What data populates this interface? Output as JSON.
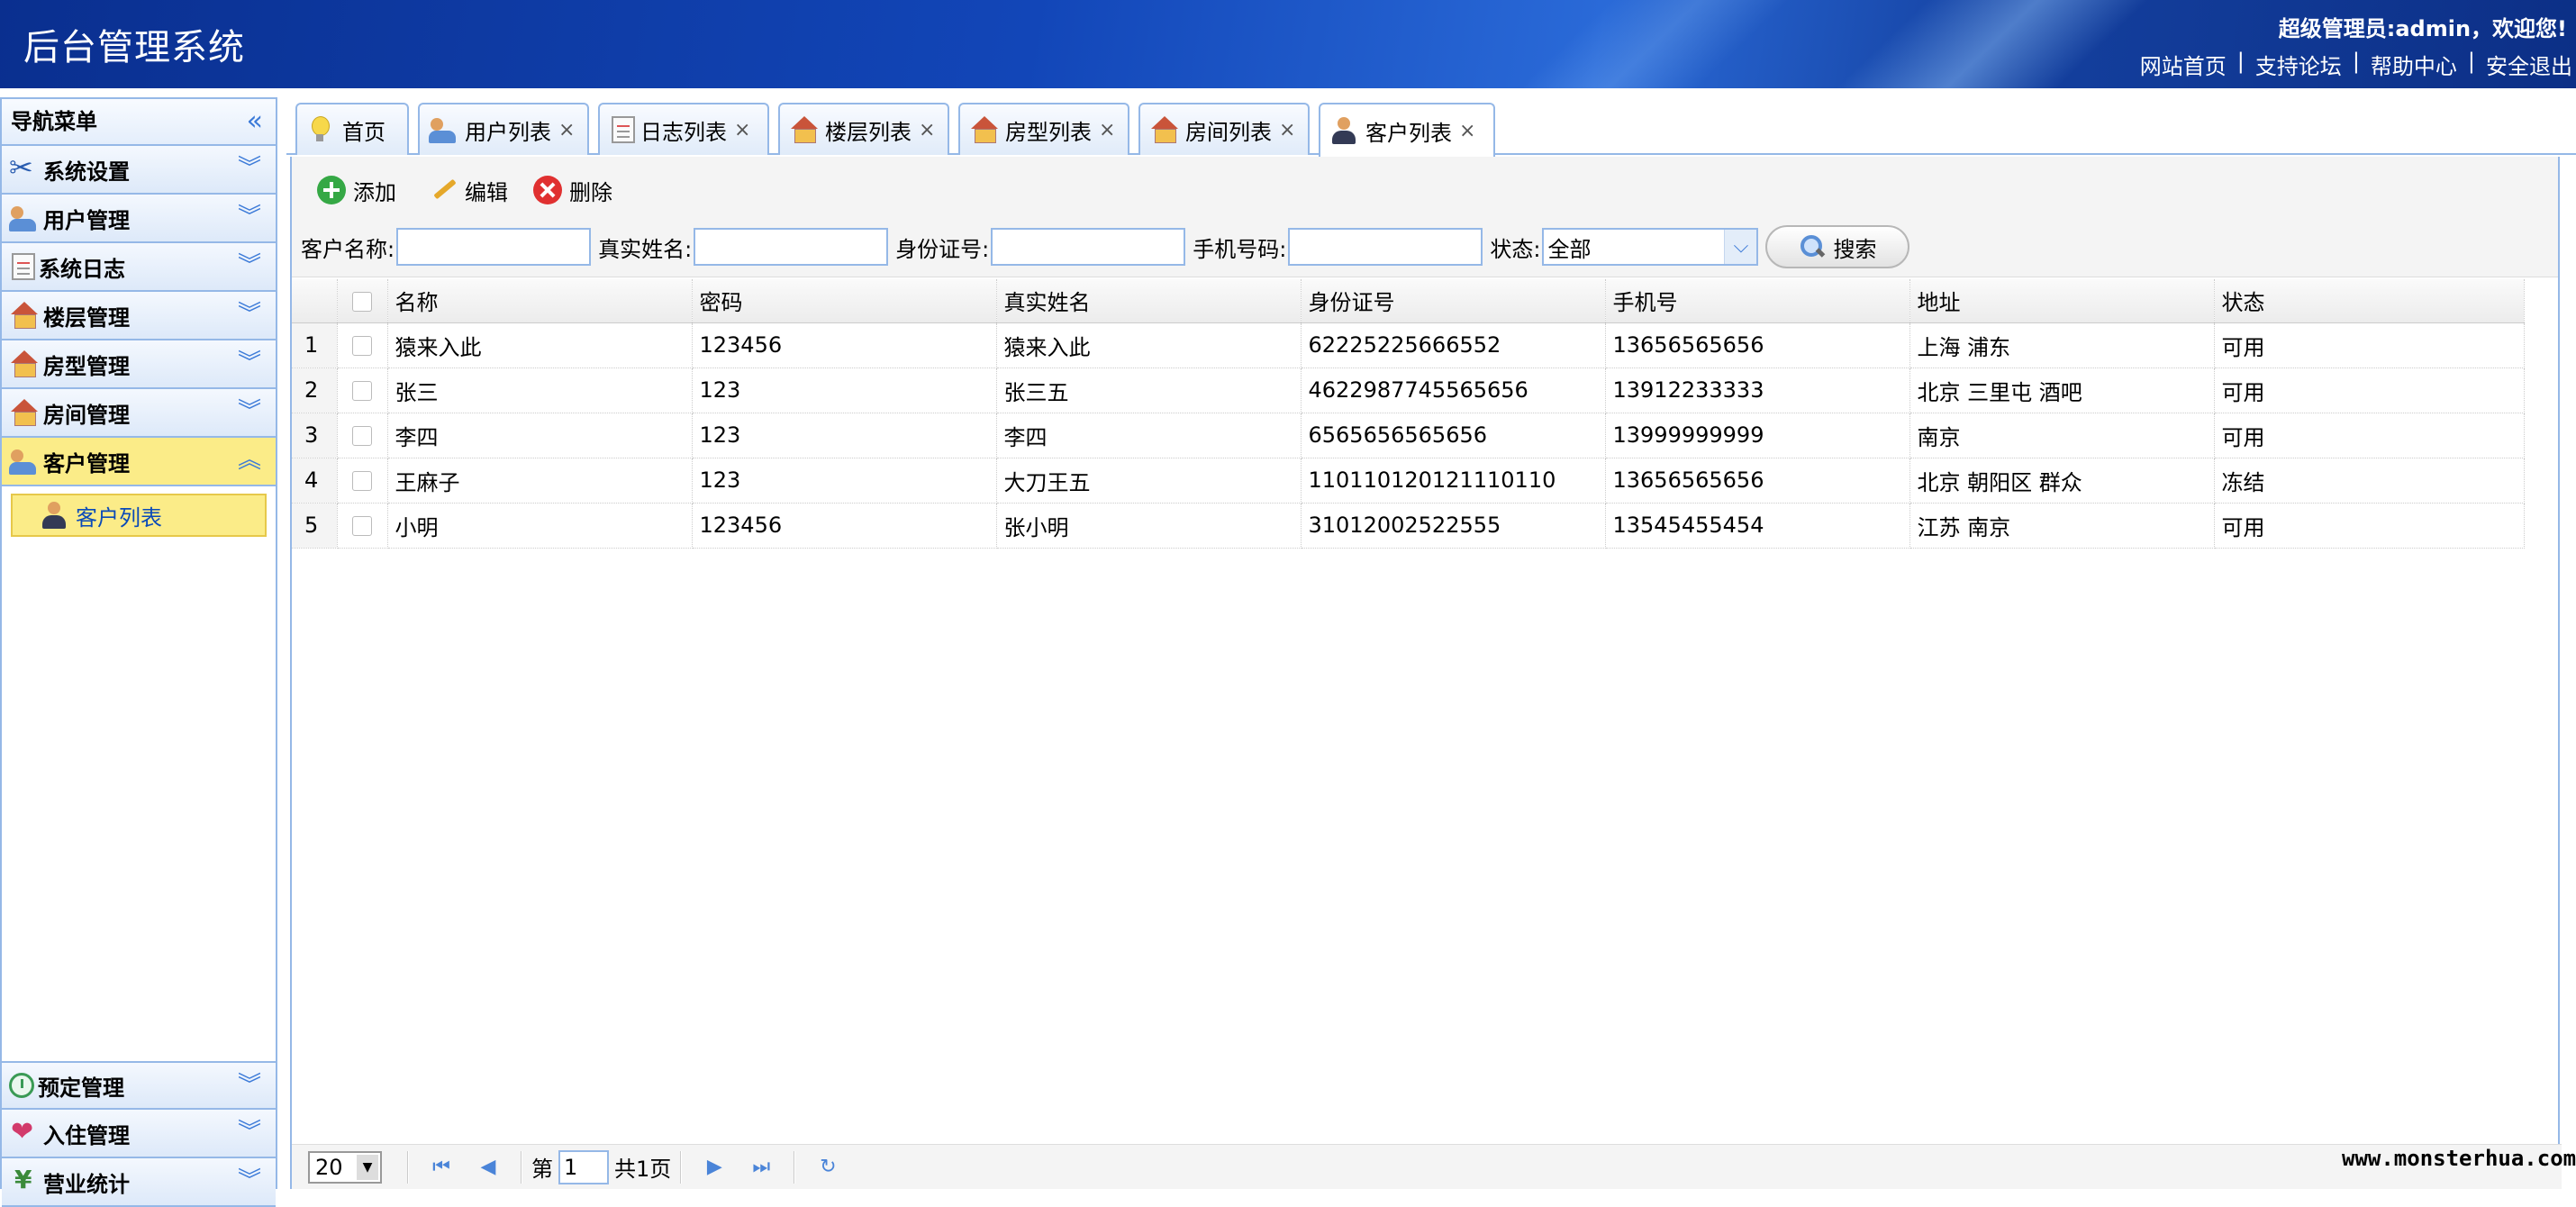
{
  "header": {
    "title": "后台管理系统",
    "welcome": "超级管理员:admin，欢迎您!",
    "links": [
      "网站首页",
      "支持论坛",
      "帮助中心",
      "安全退出"
    ],
    "separator": "|"
  },
  "sidebar": {
    "heading": "导航菜单",
    "collapse_icon": "«",
    "panels": [
      {
        "label": "系统设置",
        "icon": "tools-icon"
      },
      {
        "label": "用户管理",
        "icon": "users-icon"
      },
      {
        "label": "系统日志",
        "icon": "document-icon"
      },
      {
        "label": "楼层管理",
        "icon": "house-icon"
      },
      {
        "label": "房型管理",
        "icon": "house-icon"
      },
      {
        "label": "房间管理",
        "icon": "house-icon"
      },
      {
        "label": "客户管理",
        "icon": "users-icon",
        "active": true
      }
    ],
    "sub_items": [
      {
        "label": "客户列表",
        "icon": "person-icon"
      }
    ],
    "bottom_panels": [
      {
        "label": "预定管理",
        "icon": "clock-icon"
      },
      {
        "label": "入住管理",
        "icon": "heart-icon"
      },
      {
        "label": "营业统计",
        "icon": "yen-icon"
      }
    ]
  },
  "tabs": [
    {
      "label": "首页",
      "icon": "bulb-icon",
      "closable": false
    },
    {
      "label": "用户列表",
      "icon": "users-icon",
      "closable": true
    },
    {
      "label": "日志列表",
      "icon": "document-icon",
      "closable": true
    },
    {
      "label": "楼层列表",
      "icon": "house-icon",
      "closable": true
    },
    {
      "label": "房型列表",
      "icon": "house-icon",
      "closable": true
    },
    {
      "label": "房间列表",
      "icon": "house-icon",
      "closable": true
    },
    {
      "label": "客户列表",
      "icon": "person-icon",
      "closable": true,
      "active": true
    }
  ],
  "tab_close": "×",
  "toolbar": {
    "add_label": "添加",
    "edit_label": "编辑",
    "delete_label": "删除"
  },
  "search": {
    "customer_name_label": "客户名称:",
    "customer_name_value": "",
    "real_name_label": "真实姓名:",
    "real_name_value": "",
    "id_card_label": "身份证号:",
    "id_card_value": "",
    "phone_label": "手机号码:",
    "phone_value": "",
    "status_label": "状态:",
    "status_selected": "全部",
    "search_button": "搜索"
  },
  "table": {
    "columns": [
      "名称",
      "密码",
      "真实姓名",
      "身份证号",
      "手机号",
      "地址",
      "状态"
    ],
    "rows": [
      {
        "n": "1",
        "cells": [
          "猿来入此",
          "123456",
          "猿来入此",
          "62225225666552",
          "13656565656",
          "上海 浦东",
          "可用"
        ]
      },
      {
        "n": "2",
        "cells": [
          "张三",
          "123",
          "张三五",
          "4622987745565656",
          "13912233333",
          "北京 三里屯 酒吧",
          "可用"
        ]
      },
      {
        "n": "3",
        "cells": [
          "李四",
          "123",
          "李四",
          "6565656565656",
          "13999999999",
          "南京",
          "可用"
        ]
      },
      {
        "n": "4",
        "cells": [
          "王麻子",
          "123",
          "大刀王五",
          "110110120121110110",
          "13656565656",
          "北京 朝阳区 群众",
          "冻结"
        ]
      },
      {
        "n": "5",
        "cells": [
          "小明",
          "123456",
          "张小明",
          "31012002522555",
          "13545455454",
          "江苏 南京",
          "可用"
        ]
      }
    ]
  },
  "pager": {
    "page_size": "20",
    "page_prefix": "第",
    "current_page": "1",
    "total_pages": "共1页"
  },
  "watermark": "www.monsterhua.com",
  "colors": {
    "header": "#1246b8",
    "border": "#95b8e7",
    "active": "#fbec88"
  }
}
